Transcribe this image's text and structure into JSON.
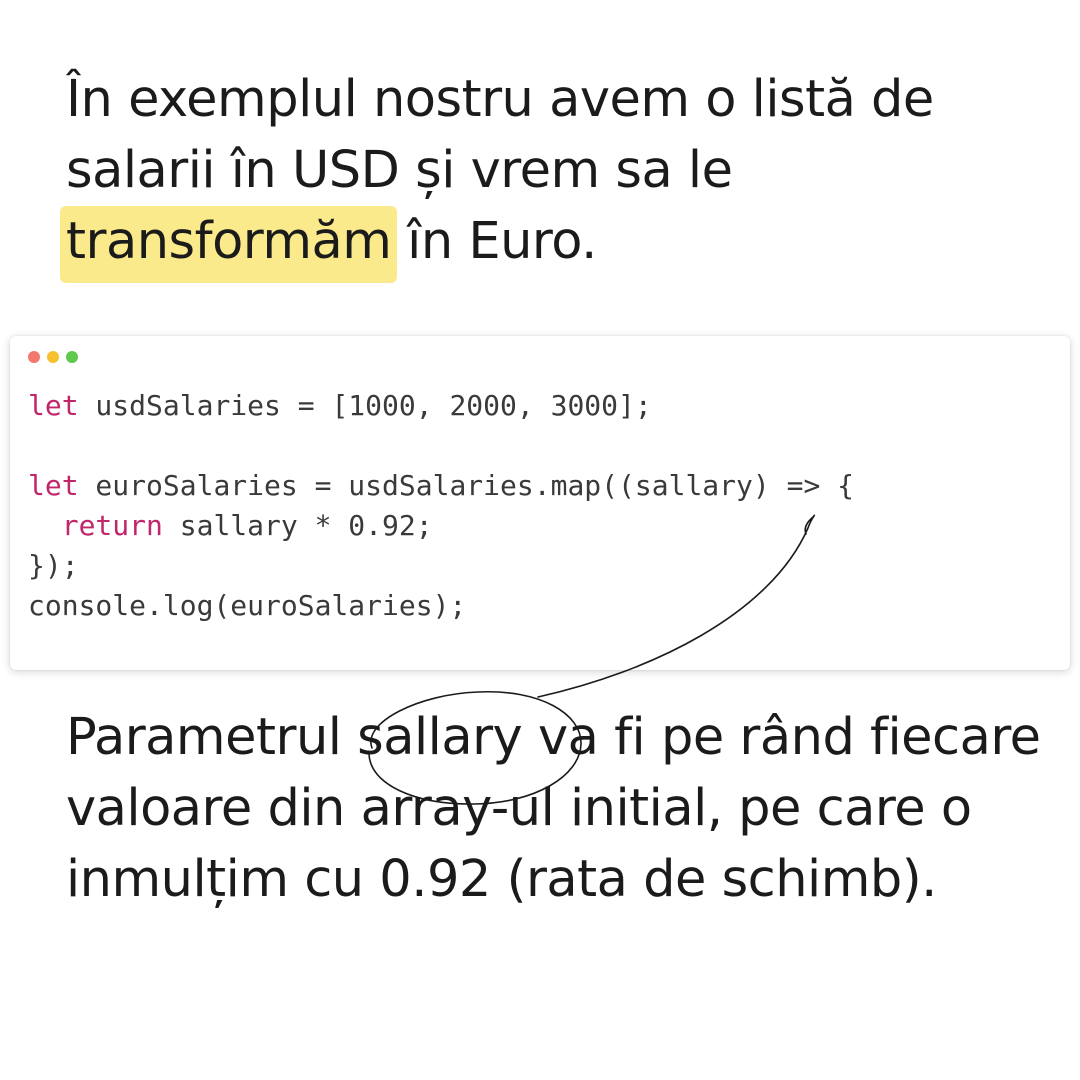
{
  "intro": {
    "before_highlight": "În exemplul nostru avem o listă de salarii în USD și vrem sa le ",
    "highlight": "transformăm",
    "after_highlight": " în Euro."
  },
  "colors": {
    "highlight": "#faea8c",
    "keyword": "#c0266a",
    "dot_red": "#f2776e",
    "dot_yellow": "#f5c12e",
    "dot_green": "#5ec94a"
  },
  "window_dots": [
    "red",
    "yellow",
    "green"
  ],
  "code": {
    "line1_kw": "let",
    "line1_rest": " usdSalaries = [1000, 2000, 3000];",
    "line3_kw": "let",
    "line3_rest": " euroSalaries = usdSalaries.map((sallary) => {",
    "line4_indent": "  ",
    "line4_kw": "return",
    "line4_rest": " sallary * 0.92;",
    "line5": "});",
    "line6": "console.log(euroSalaries);"
  },
  "explain": {
    "before_word": "Parametrul ",
    "circled_word": "sallary",
    "after_word": " va fi pe rând fiecare valoare din array-ul initial, pe care o inmulțim cu 0.92 (rata de schimb)."
  }
}
